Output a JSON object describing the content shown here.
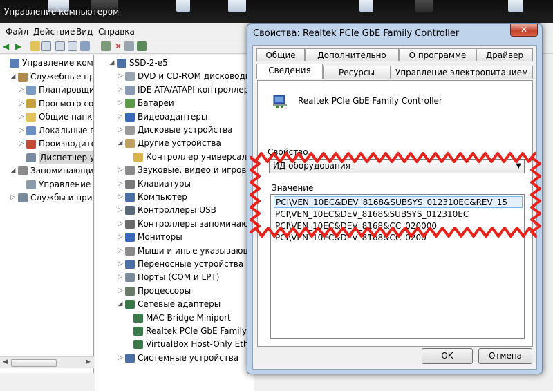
{
  "taskbar": {
    "title": "Управление компьютером"
  },
  "menu": [
    "Файл",
    "Действие",
    "Вид",
    "Справка"
  ],
  "left_tree": [
    {
      "label": "Управление компью",
      "indent": 0,
      "expander": "",
      "icon": "computer-mgmt-icon",
      "color": "#5a7fb5"
    },
    {
      "label": "Служебные прогр",
      "indent": 1,
      "expander": "◢",
      "icon": "tools-icon",
      "color": "#b08a4a"
    },
    {
      "label": "Планировщик з",
      "indent": 2,
      "expander": "▷",
      "icon": "clock-icon",
      "color": "#7a9cc4"
    },
    {
      "label": "Просмотр собы",
      "indent": 2,
      "expander": "▷",
      "icon": "event-viewer-icon",
      "color": "#c7a040"
    },
    {
      "label": "Общие папки",
      "indent": 2,
      "expander": "▷",
      "icon": "shared-folder-icon",
      "color": "#e2c25a"
    },
    {
      "label": "Локальные пол",
      "indent": 2,
      "expander": "▷",
      "icon": "users-icon",
      "color": "#6a8fc4"
    },
    {
      "label": "Производитель",
      "indent": 2,
      "expander": "▷",
      "icon": "performance-icon",
      "color": "#c04a3a"
    },
    {
      "label": "Диспетчер устр",
      "indent": 2,
      "expander": "",
      "icon": "device-manager-icon",
      "color": "#7a8aa0",
      "selected": true
    },
    {
      "label": "Запоминающие у",
      "indent": 1,
      "expander": "◢",
      "icon": "storage-icon",
      "color": "#8a8a8a"
    },
    {
      "label": "Управление ди",
      "indent": 2,
      "expander": "",
      "icon": "disk-icon",
      "color": "#8a9aaa"
    },
    {
      "label": "Службы и прилож",
      "indent": 1,
      "expander": "▷",
      "icon": "services-icon",
      "color": "#7a8a9a"
    }
  ],
  "right_tree": [
    {
      "label": "SSD-2-e5",
      "indent": 0,
      "expander": "◢",
      "icon": "computer-icon",
      "color": "#4a6fa5"
    },
    {
      "label": "DVD и CD-ROM дисководы",
      "indent": 1,
      "expander": "▷",
      "icon": "dvd-drive-icon",
      "color": "#9aa4b0"
    },
    {
      "label": "IDE ATA/ATAPI контроллеры",
      "indent": 1,
      "expander": "▷",
      "icon": "ide-controller-icon",
      "color": "#8a9ab0"
    },
    {
      "label": "Батареи",
      "indent": 1,
      "expander": "▷",
      "icon": "battery-icon",
      "color": "#5a9a4a"
    },
    {
      "label": "Видеоадаптеры",
      "indent": 1,
      "expander": "▷",
      "icon": "display-adapter-icon",
      "color": "#3a6ab5"
    },
    {
      "label": "Дисковые устройства",
      "indent": 1,
      "expander": "▷",
      "icon": "disk-drive-icon",
      "color": "#9a9a9a"
    },
    {
      "label": "Другие устройства",
      "indent": 1,
      "expander": "◢",
      "icon": "other-devices-icon",
      "color": "#c0a060"
    },
    {
      "label": "Контроллер универсаль",
      "indent": 2,
      "expander": "",
      "icon": "unknown-device-icon",
      "color": "#d8b24a"
    },
    {
      "label": "Звуковые, видео и игровые",
      "indent": 1,
      "expander": "▷",
      "icon": "sound-icon",
      "color": "#8a8a8a"
    },
    {
      "label": "Клавиатуры",
      "indent": 1,
      "expander": "▷",
      "icon": "keyboard-icon",
      "color": "#7a7a7a"
    },
    {
      "label": "Компьютер",
      "indent": 1,
      "expander": "▷",
      "icon": "computer-icon",
      "color": "#4a6fa5"
    },
    {
      "label": "Контроллеры USB",
      "indent": 1,
      "expander": "▷",
      "icon": "usb-icon",
      "color": "#5a6a7a"
    },
    {
      "label": "Контроллеры запоминающ",
      "indent": 1,
      "expander": "▷",
      "icon": "storage-controller-icon",
      "color": "#6a6a6a"
    },
    {
      "label": "Мониторы",
      "indent": 1,
      "expander": "▷",
      "icon": "monitor-icon",
      "color": "#3a6ab5"
    },
    {
      "label": "Мыши и иные указывающ",
      "indent": 1,
      "expander": "▷",
      "icon": "mouse-icon",
      "color": "#8a8a8a"
    },
    {
      "label": "Переносные устройства",
      "indent": 1,
      "expander": "▷",
      "icon": "portable-device-icon",
      "color": "#4a6fa5"
    },
    {
      "label": "Порты (COM и LPT)",
      "indent": 1,
      "expander": "▷",
      "icon": "port-icon",
      "color": "#7a8a9a"
    },
    {
      "label": "Процессоры",
      "indent": 1,
      "expander": "▷",
      "icon": "cpu-icon",
      "color": "#6a7a6a"
    },
    {
      "label": "Сетевые адаптеры",
      "indent": 1,
      "expander": "◢",
      "icon": "network-adapter-icon",
      "color": "#3a7a4a"
    },
    {
      "label": "MAC Bridge Miniport",
      "indent": 2,
      "expander": "",
      "icon": "network-card-icon",
      "color": "#3a7a4a"
    },
    {
      "label": "Realtek PCIe GbE Family C",
      "indent": 2,
      "expander": "",
      "icon": "network-card-icon",
      "color": "#3a7a4a"
    },
    {
      "label": "VirtualBox Host-Only Ethe",
      "indent": 2,
      "expander": "",
      "icon": "network-card-icon",
      "color": "#3a7a4a"
    },
    {
      "label": "Системные устройства",
      "indent": 1,
      "expander": "▷",
      "icon": "system-devices-icon",
      "color": "#4a6fa5"
    }
  ],
  "dialog": {
    "title": "Свойства: Realtek PCIe GbE Family Controller",
    "close": "✕",
    "tabs_back": [
      "Общие",
      "Дополнительно",
      "О программе",
      "Драйвер"
    ],
    "tabs_front": [
      "Сведения",
      "Ресурсы",
      "Управление электропитанием"
    ],
    "device_name": "Realtek PCIe GbE Family Controller",
    "property_label": "Свойство",
    "property_value": "ИД оборудования",
    "value_label": "Значение",
    "values": [
      "PCI\\VEN_10EC&DEV_8168&SUBSYS_012310EC&REV_15",
      "PCI\\VEN_10EC&DEV_8168&SUBSYS_012310EC",
      "PCI\\VEN_10EC&DEV_8168&CC_020000",
      "PCI\\VEN_10EC&DEV_8168&CC_0200"
    ],
    "ok": "OK",
    "cancel": "Отмена"
  },
  "colors": {
    "highlight_outline": "#e8231c",
    "selection": "#e5f0fb"
  }
}
